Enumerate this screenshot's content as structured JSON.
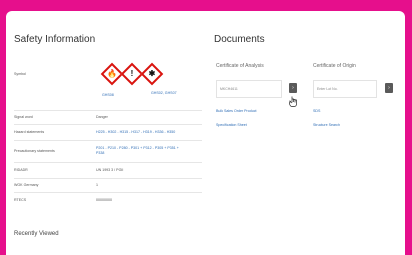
{
  "safety": {
    "title": "Safety Information",
    "rows": [
      {
        "label": "Symbol",
        "value": ""
      },
      {
        "label": "Signal word",
        "value": "Danger"
      },
      {
        "label": "Hazard statements",
        "value": "H225 - H302 - H315 - H317 - H319 - H336 - H350"
      },
      {
        "label": "Precautionary statements",
        "value": "P201 - P210 - P280 - P301 + P312 - P305 + P351 + P338"
      },
      {
        "label": "RIDADR",
        "value": "UN 1993 3 / PGII"
      },
      {
        "label": "WGK Germany",
        "value": "1"
      },
      {
        "label": "RTECS",
        "value": "00000000"
      }
    ],
    "pictogram_codes": "GHS02, GHS07",
    "pictogram_link": "GHS08",
    "pictograms": [
      {
        "icon": "flame-icon",
        "glyph": "🔥"
      },
      {
        "icon": "exclamation-icon",
        "glyph": "!"
      },
      {
        "icon": "health-hazard-icon",
        "glyph": "✱"
      }
    ],
    "recent": "Recently Viewed"
  },
  "documents": {
    "title": "Documents",
    "coa": {
      "heading": "Certificate of Analysis",
      "placeholder": "MKCH4611",
      "links": [
        "Bulk Sales Order Product",
        "Specification Sheet"
      ]
    },
    "coo": {
      "heading": "Certificate of Origin",
      "placeholder": "Enter Lot No.",
      "links": [
        "SDS",
        "Structure Search"
      ]
    },
    "button_glyph": "›"
  },
  "colors": {
    "frame": "#e60f8c",
    "link": "#2f6db5",
    "ghs_red": "#d9140f"
  }
}
